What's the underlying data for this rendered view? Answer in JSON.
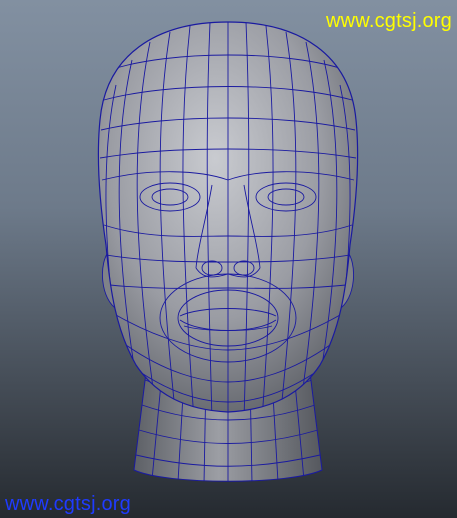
{
  "viewport": {
    "subject": "head-wireframe-model",
    "background_top": "#8290a1",
    "background_bottom": "#252a30",
    "mesh_color": "#1a1aa0",
    "shade_color": "#a8aab0"
  },
  "watermarks": {
    "top": "www.cgtsj.org",
    "bottom": "www.cgtsj.org",
    "top_color": "#ffff00",
    "bottom_color": "#1f3bff"
  }
}
